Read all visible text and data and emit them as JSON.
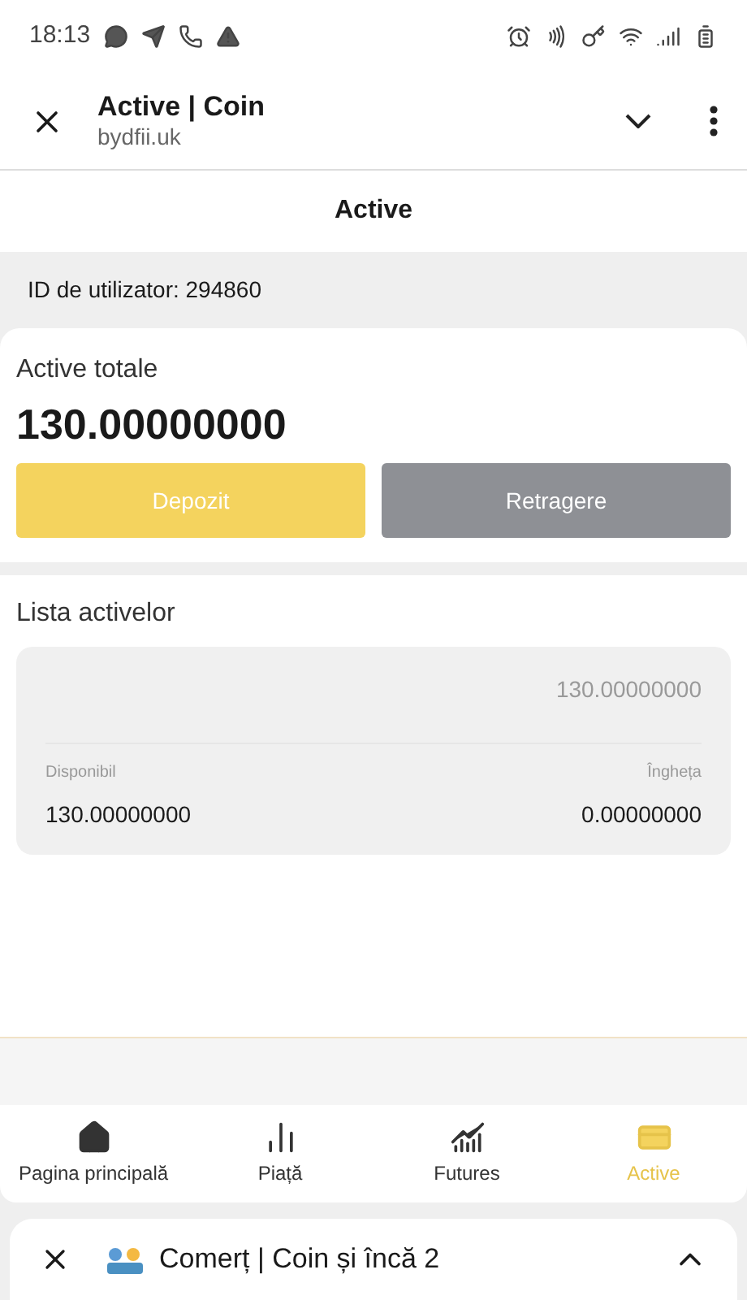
{
  "status_bar": {
    "time": "18:13"
  },
  "browser_bar": {
    "title": "Active | Coin",
    "url": "bydfii.uk"
  },
  "page_title": "Active",
  "user_id": "ID de utilizator: 294860",
  "summary": {
    "label": "Active totale",
    "total": "130.00000000",
    "buttons": [
      {
        "label": "Depozit",
        "kind": "primary"
      },
      {
        "label": "Retragere",
        "kind": "secondary"
      }
    ]
  },
  "asset_list": {
    "title": "Lista activelor",
    "items": [
      {
        "total": "130.00000000",
        "available_label": "Disponibil",
        "available": "130.00000000",
        "frozen_label": "Îngheța",
        "frozen": "0.00000000"
      }
    ]
  },
  "nav": [
    {
      "label": "Pagina principală",
      "kind": "home",
      "selected": false
    },
    {
      "label": "Piață",
      "kind": "bars",
      "selected": false
    },
    {
      "label": "Futures",
      "kind": "trend",
      "selected": false
    },
    {
      "label": "Active",
      "kind": "card",
      "selected": true
    }
  ],
  "tab_sheet": {
    "title": "Comerț | Coin și încă 2"
  }
}
